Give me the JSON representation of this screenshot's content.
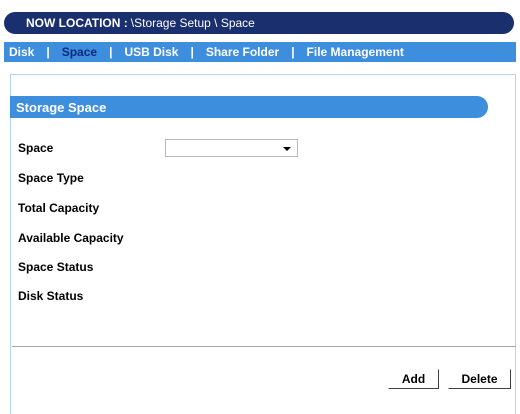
{
  "location": {
    "label": "NOW LOCATION :",
    "path": "\\Storage Setup \\ Space"
  },
  "tabs": [
    {
      "label": "Disk",
      "active": false
    },
    {
      "label": "Space",
      "active": true
    },
    {
      "label": "USB Disk",
      "active": false
    },
    {
      "label": "Share Folder",
      "active": false
    },
    {
      "label": "File Management",
      "active": false
    }
  ],
  "tab_separator": "|",
  "section": {
    "title": "Storage Space"
  },
  "fields": {
    "space": {
      "label": "Space",
      "selected_value": ""
    },
    "space_type": {
      "label": "Space Type",
      "value": ""
    },
    "total_capacity": {
      "label": "Total Capacity",
      "value": ""
    },
    "available_capacity": {
      "label": "Available Capacity",
      "value": ""
    },
    "space_status": {
      "label": "Space Status",
      "value": ""
    },
    "disk_status": {
      "label": "Disk Status",
      "value": ""
    }
  },
  "buttons": {
    "add_label": "Add",
    "delete_label": "Delete"
  },
  "colors": {
    "location_bar": "#1a2f6e",
    "tab_strip": "#3e8ede",
    "active_tab_text": "#0b2a7a",
    "section_header": "#3e8ede"
  }
}
